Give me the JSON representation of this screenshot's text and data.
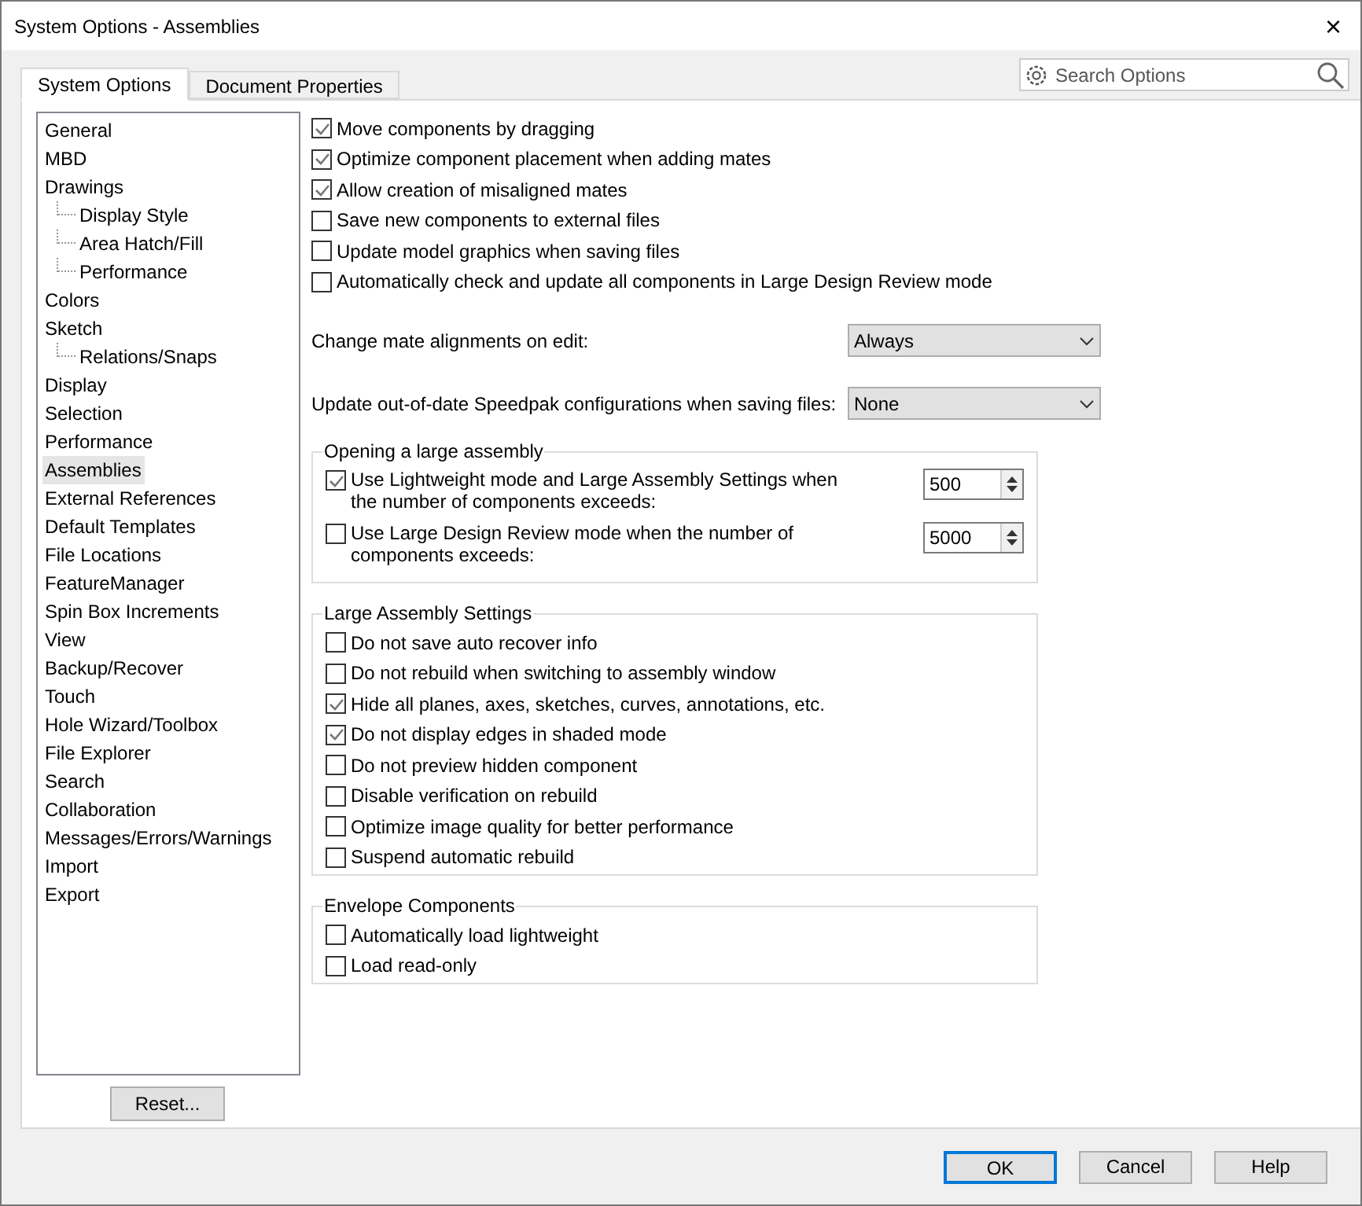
{
  "window": {
    "title": "System Options - Assemblies",
    "close": "×"
  },
  "tabs": [
    {
      "label": "System Options",
      "selected": true
    },
    {
      "label": "Document Properties",
      "selected": false
    }
  ],
  "search": {
    "placeholder": "Search Options"
  },
  "tree": [
    {
      "label": "General",
      "selected": false
    },
    {
      "label": "MBD",
      "selected": false
    },
    {
      "label": "Drawings",
      "selected": false,
      "children": [
        {
          "label": "Display Style",
          "selected": false
        },
        {
          "label": "Area Hatch/Fill",
          "selected": false
        },
        {
          "label": "Performance",
          "selected": false
        }
      ]
    },
    {
      "label": "Colors",
      "selected": false
    },
    {
      "label": "Sketch",
      "selected": false,
      "children": [
        {
          "label": "Relations/Snaps",
          "selected": false
        }
      ]
    },
    {
      "label": "Display",
      "selected": false
    },
    {
      "label": "Selection",
      "selected": false
    },
    {
      "label": "Performance",
      "selected": false
    },
    {
      "label": "Assemblies",
      "selected": true
    },
    {
      "label": "External References",
      "selected": false
    },
    {
      "label": "Default Templates",
      "selected": false
    },
    {
      "label": "File Locations",
      "selected": false
    },
    {
      "label": "FeatureManager",
      "selected": false
    },
    {
      "label": "Spin Box Increments",
      "selected": false
    },
    {
      "label": "View",
      "selected": false
    },
    {
      "label": "Backup/Recover",
      "selected": false
    },
    {
      "label": "Touch",
      "selected": false
    },
    {
      "label": "Hole Wizard/Toolbox",
      "selected": false
    },
    {
      "label": "File Explorer",
      "selected": false
    },
    {
      "label": "Search",
      "selected": false
    },
    {
      "label": "Collaboration",
      "selected": false
    },
    {
      "label": "Messages/Errors/Warnings",
      "selected": false
    },
    {
      "label": "Import",
      "selected": false
    },
    {
      "label": "Export",
      "selected": false
    }
  ],
  "reset_button": "Reset...",
  "options": [
    {
      "label": "Move components by dragging",
      "checked": true
    },
    {
      "label": "Optimize component placement when adding mates",
      "checked": true
    },
    {
      "label": "Allow creation of misaligned mates",
      "checked": true
    },
    {
      "label": "Save new components to external files",
      "checked": false
    },
    {
      "label": "Update model graphics when saving files",
      "checked": false
    },
    {
      "label": "Automatically check and update all components in Large Design Review mode",
      "checked": false
    }
  ],
  "dropdowns": [
    {
      "label": "Change mate alignments on edit:",
      "value": "Always"
    },
    {
      "label": "Update out-of-date Speedpak configurations when saving files:",
      "value": "None"
    }
  ],
  "opening_group": {
    "title": "Opening a large assembly",
    "items": [
      {
        "label": "Use Lightweight mode and Large Assembly Settings when the number of components exceeds:",
        "checked": true,
        "value": "500"
      },
      {
        "label": "Use Large Design Review mode when the number of components exceeds:",
        "checked": false,
        "value": "5000"
      }
    ]
  },
  "groups": [
    {
      "title": "Large Assembly Settings",
      "items": [
        {
          "label": "Do not save auto recover info",
          "checked": false
        },
        {
          "label": "Do not rebuild when switching to assembly window",
          "checked": false
        },
        {
          "label": "Hide all planes, axes, sketches, curves, annotations, etc.",
          "checked": true
        },
        {
          "label": "Do not display edges in shaded mode",
          "checked": true
        },
        {
          "label": "Do not preview hidden component",
          "checked": false
        },
        {
          "label": "Disable verification on rebuild",
          "checked": false
        },
        {
          "label": "Optimize image quality for better performance",
          "checked": false
        },
        {
          "label": "Suspend automatic rebuild",
          "checked": false
        }
      ]
    },
    {
      "title": "Envelope Components",
      "items": [
        {
          "label": "Automatically load lightweight",
          "checked": false
        },
        {
          "label": "Load read-only",
          "checked": false
        }
      ]
    }
  ],
  "buttons": [
    {
      "label": "OK",
      "default": true
    },
    {
      "label": "Cancel",
      "default": false
    },
    {
      "label": "Help",
      "default": false
    }
  ]
}
